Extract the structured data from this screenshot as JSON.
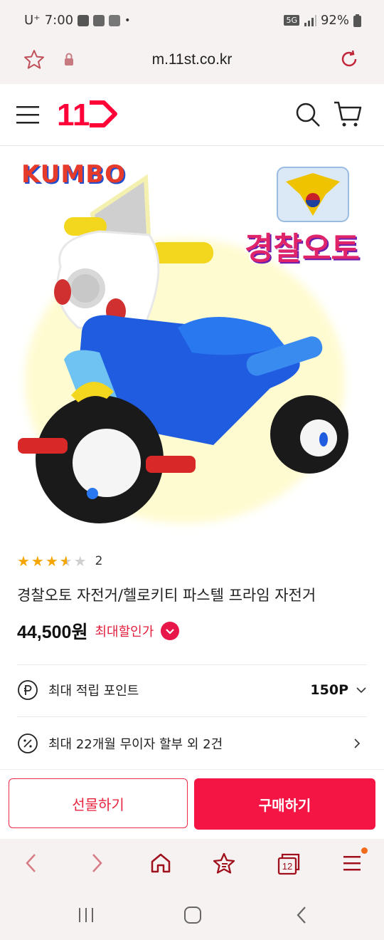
{
  "status": {
    "carrier": "U⁺",
    "time": "7:00",
    "battery": "92%"
  },
  "browser": {
    "url": "m.11st.co.kr",
    "tab_count": "12"
  },
  "header": {
    "logo_text": "11"
  },
  "hero": {
    "brand_logo": "KUMBO",
    "product_logo": "경찰오토"
  },
  "product": {
    "rating": 3.5,
    "review_count": "2",
    "title": "경찰오토 자전거/헬로키티 파스텔 프라임 자전거",
    "price": "44,500원",
    "max_discount_label": "최대할인가"
  },
  "rows": [
    {
      "label": "최대 적립 포인트",
      "value": "150P"
    },
    {
      "label": "최대 22개월 무이자 할부 외 2건",
      "value": ""
    }
  ],
  "buttons": {
    "gift": "선물하기",
    "buy": "구매하기"
  },
  "colors": {
    "accent": "#f41544",
    "brand": "#ff0038"
  }
}
